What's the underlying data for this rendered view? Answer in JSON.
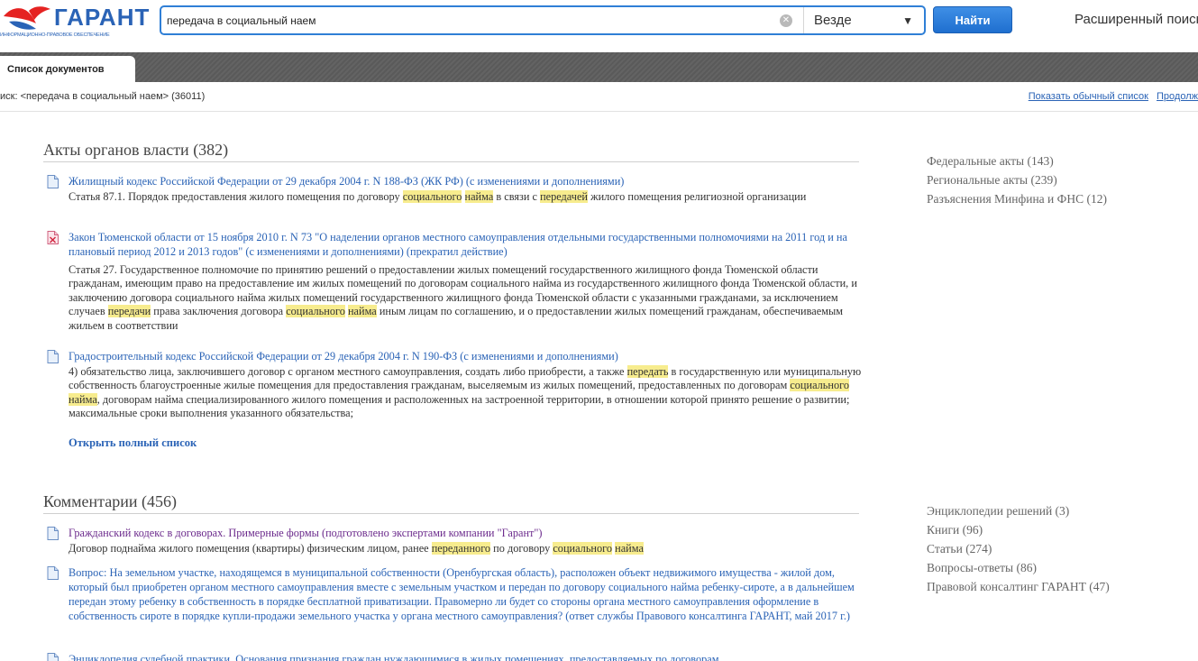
{
  "header": {
    "logo_text": "ГАРАНТ",
    "logo_tagline": "ИНФОРМАЦИОННО-ПРАВОВОЕ ОБЕСПЕЧЕНИЕ",
    "search_value": "передача в социальный наем",
    "search_placeholder": "",
    "scope_selected": "Везде",
    "find_button": "Найти",
    "advanced_search": "Расширенный поиск"
  },
  "tabs": [
    {
      "label": "Список документов",
      "active": true
    }
  ],
  "info_row": {
    "query": "иск: <передача в социальный наем> (36011)",
    "show_plain_list": "Показать обычный список",
    "continue_link": "Продолж"
  },
  "sections": [
    {
      "heading": "Акты органов власти (382)",
      "open_full": "Открыть полный список",
      "docs": [
        {
          "icon": "document-icon",
          "title": "Жилищный кодекс Российской Федерации от 29 декабря 2004 г. N 188-ФЗ (ЖК РФ) (с изменениями и дополнениями)",
          "snippet": [
            {
              "t": "Статья 87.1. Порядок предоставления жилого помещения по договору "
            },
            {
              "t": "социального",
              "h": true
            },
            {
              "t": " "
            },
            {
              "t": "найма",
              "h": true
            },
            {
              "t": " в связи с "
            },
            {
              "t": "передачей",
              "h": true
            },
            {
              "t": " жилого помещения религиозной организации"
            }
          ]
        },
        {
          "icon": "expired-document-icon",
          "title": "Закон Тюменской области от 15 ноября 2010 г. N 73 \"О наделении органов местного самоуправления отдельными государственными полномочиями на 2011 год и на плановый период 2012 и 2013 годов\" (с изменениями и дополнениями) (прекратил действие)",
          "snippet": [
            {
              "t": "Статья 27. Государственное полномочие по принятию решений о предоставлении жилых помещений государственного жилищного фонда Тюменской области гражданам, имеющим право на предоставление им жилых помещений по договорам социального найма из государственного жилищного фонда Тюменской области, и заключению договора социального найма жилых помещений государственного жилищного фонда Тюменской области с указанными гражданами, за исключением случаев "
            },
            {
              "t": "передачи",
              "h": true
            },
            {
              "t": " права заключения договора "
            },
            {
              "t": "социального",
              "h": true
            },
            {
              "t": " "
            },
            {
              "t": "найма",
              "h": true
            },
            {
              "t": " иным лицам по соглашению, и о предоставлении жилых помещений гражданам, обеспечиваемым жильем в соответствии"
            }
          ]
        },
        {
          "icon": "document-icon",
          "title": "Градостроительный кодекс Российской Федерации от 29 декабря 2004 г. N 190-ФЗ (с изменениями и дополнениями)",
          "snippet": [
            {
              "t": "4) обязательство лица, заключившего договор с органом местного самоуправления, создать либо приобрести, а также "
            },
            {
              "t": "передать",
              "h": true
            },
            {
              "t": " в государственную или муниципальную собственность благоустроенные жилые помещения для предоставления гражданам, выселяемым из жилых помещений, предоставленных по договорам "
            },
            {
              "t": "социального",
              "h": true
            },
            {
              "t": " "
            },
            {
              "t": "найма",
              "h": true
            },
            {
              "t": ", договорам найма специализированного жилого помещения и расположенных на застроенной территории, в отношении которой принято решение о развитии; максимальные сроки выполнения указанного обязательства;"
            }
          ]
        }
      ]
    },
    {
      "heading": "Комментарии (456)",
      "docs": [
        {
          "icon": "document-icon",
          "visited": true,
          "title": "Гражданский кодекс в договорах. Примерные формы (подготовлено экспертами компании \"Гарант\")",
          "snippet": [
            {
              "t": "Договор поднайма жилого помещения (квартиры) физическим лицом, ранее "
            },
            {
              "t": "переданного",
              "h": true
            },
            {
              "t": " по договору "
            },
            {
              "t": "социального",
              "h": true
            },
            {
              "t": " "
            },
            {
              "t": "найма",
              "h": true
            }
          ]
        },
        {
          "icon": "document-icon",
          "title": "Вопрос: На земельном участке, находящемся в муниципальной собственности (Оренбургская область), расположен объект недвижимого имущества - жилой дом, который был приобретен органом местного самоуправления вместе с земельным участком и передан по договору социального найма ребенку-сироте, а в дальнейшем передан этому ребенку в собственность в порядке бесплатной приватизации. Правомерно ли будет со стороны органа местного самоуправления оформление в собственность сироте в порядке купли-продажи земельного участка у органа местного самоуправления? (ответ службы Правового консалтинга ГАРАНТ, май 2017 г.)",
          "snippet": []
        },
        {
          "icon": "document-icon",
          "title": "Энциклопедия судебной практики. Основания признания граждан нуждающимися в жилых помещениях, предоставляемых по договорам",
          "snippet": []
        }
      ]
    }
  ],
  "sidebar_top": [
    "Федеральные акты (143)",
    "Региональные акты (239)",
    "Разъяснения Минфина и ФНС (12)"
  ],
  "sidebar_bottom": [
    "Энциклопедии решений (3)",
    "Книги (96)",
    "Статьи (274)",
    "Вопросы-ответы (86)",
    "Правовой консалтинг ГАРАНТ (47)"
  ]
}
